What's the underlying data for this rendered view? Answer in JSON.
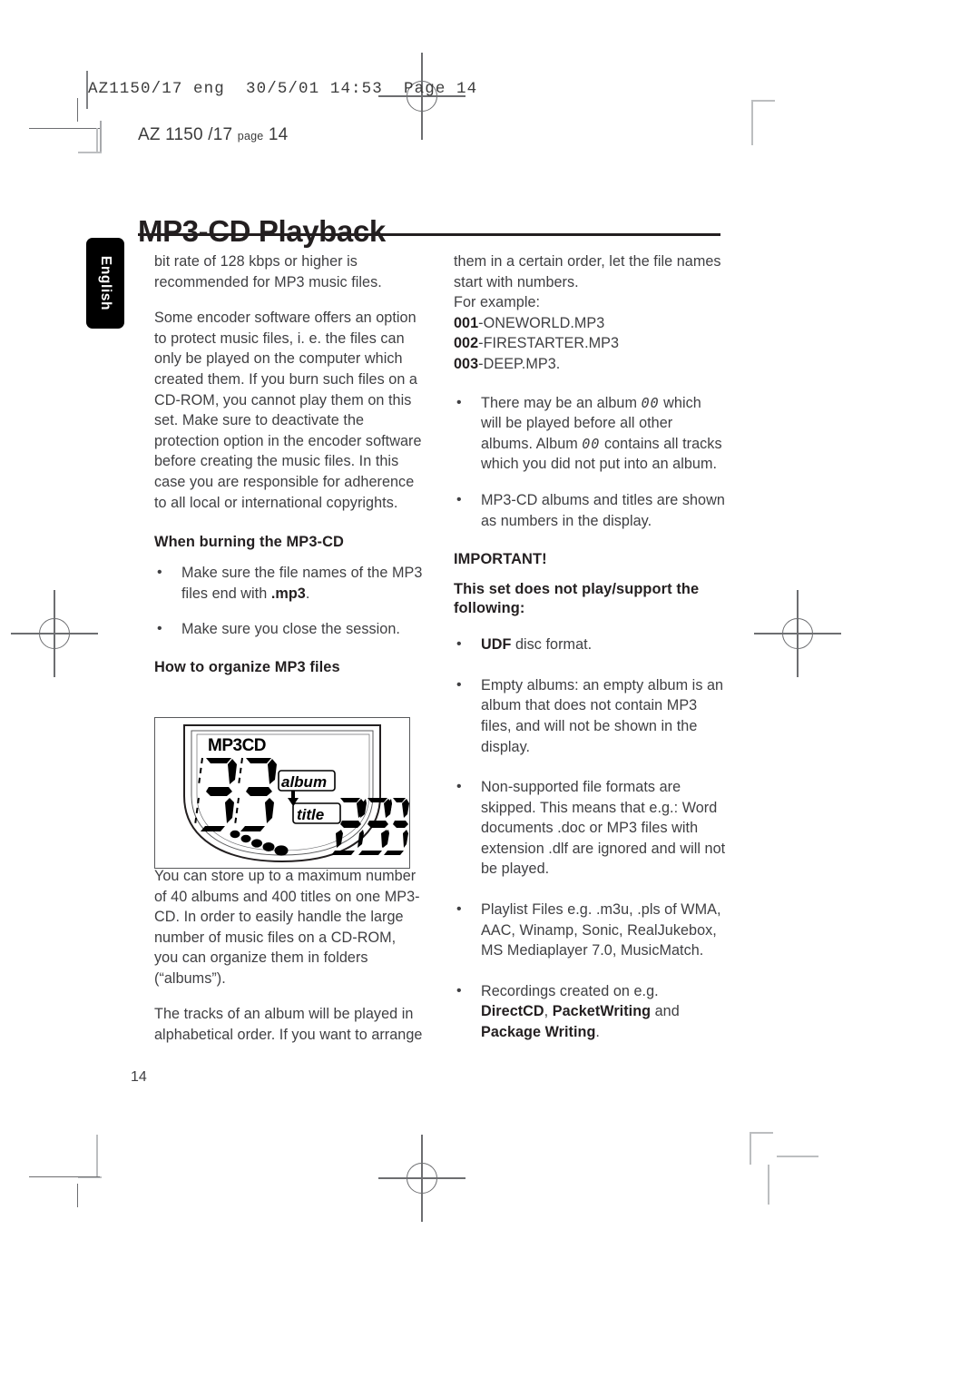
{
  "print_marks": {
    "slug_text": "AZ1150/17 eng  30/5/01 14:53  Page 14",
    "running_head_main": "AZ 1150 /17",
    "running_head_small": "page",
    "running_head_page": "14"
  },
  "language_tab": {
    "label": "English"
  },
  "header": {
    "title": "MP3-CD Playback"
  },
  "left_column": {
    "para_1": "bit rate of 128 kbps or higher is recommended for MP3 music files.",
    "para_2": "Some encoder software offers an option to protect music files, i. e. the files can only be played on the computer which created them. If you burn such files on a CD-ROM, you cannot play them on this set. Make sure to deactivate the protection option in the encoder software before creating the music files. In this case you are responsible for adherence to all local or international copyrights.",
    "heading_burning": "When burning the MP3-CD",
    "bullet_1_pre": "Make sure the file names of the MP3 files end with ",
    "bullet_1_bold": ".mp3",
    "bullet_1_post": ".",
    "bullet_2": "Make sure you close the session.",
    "heading_organize": "How to organize MP3 files",
    "para_3": "You can store up to a maximum number of 40 albums and 400 titles on one MP3-CD. In order to easily handle the large number of music files on a CD-ROM,",
    "para_4": "you can organize them in folders (“albums”).",
    "para_5": "The tracks of an album will be played in alphabetical order. If you want to arrange",
    "bullet_glyph": "•"
  },
  "figure": {
    "name": "mp3cd-display-illustration",
    "lcd_label": "MP3CD",
    "album_number": "33",
    "album_text": "album",
    "title_text": "title",
    "title_number": "288",
    "dot_count": 5
  },
  "right_column": {
    "para_1": "them in a certain order, let the file names start with numbers.",
    "para_2": "For example:",
    "example_1_bold": "001",
    "example_1_rest": "-ONEWORLD.MP3",
    "example_2_bold": "002",
    "example_2_rest": "-FIRESTARTER.MP3",
    "example_3_bold": "003",
    "example_3_rest": "-DEEP.MP3.",
    "bullet_1_a": "There may be an album ",
    "bullet_1_seg1": "00",
    "bullet_1_b": " which will be played before all other albums. Album ",
    "bullet_1_seg2": "00",
    "bullet_1_c": " contains all tracks which you did not put into an album.",
    "bullet_2": "MP3-CD albums and titles are shown as numbers in the display.",
    "heading_important": "IMPORTANT!",
    "heading_notsupported": "This set does not play/support the following:",
    "bullet_3_bold": "UDF",
    "bullet_3_rest": " disc format.",
    "bullet_4": "Empty albums: an empty album is an album that does not contain MP3 files, and will not be shown in the display.",
    "bullet_5": "Non-supported file formats are skipped. This means that e.g.: Word documents .doc or MP3 files with extension .dlf are ignored and will not be played.",
    "bullet_6": "Playlist Files e.g. .m3u, .pls of WMA, AAC, Winamp, Sonic, RealJukebox, MS Mediaplayer 7.0, MusicMatch.",
    "bullet_7_a": "Recordings created on e.g. ",
    "bullet_7_b1": "DirectCD",
    "bullet_7_b": ", ",
    "bullet_7_b2": "PacketWriting",
    "bullet_7_c": " and ",
    "bullet_7_b3": "Package Writing",
    "bullet_7_d": ".",
    "bullet_glyph": "•"
  },
  "footer": {
    "page_number": "14"
  },
  "colors": {
    "ink": "#231f20",
    "body_text": "#3f3f42",
    "mark": "#6d6e71",
    "mark_light": "#bcbec0",
    "tab_background": "#000000",
    "tab_text": "#ffffff"
  }
}
